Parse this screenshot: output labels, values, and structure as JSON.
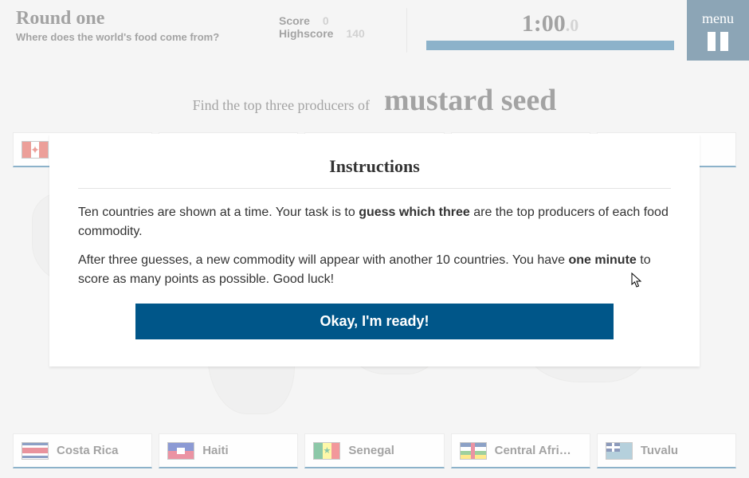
{
  "header": {
    "round_title": "Round one",
    "subtitle": "Where does the world's food come from?",
    "score_label": "Score",
    "score_value": "0",
    "highscore_label": "Highscore",
    "highscore_value": "140",
    "time_main": "1:00",
    "time_dec": ".0",
    "progress_pct": 100,
    "menu_label": "menu"
  },
  "prompt": {
    "lead": "Find the top three producers of",
    "commodity": "mustard seed"
  },
  "countries_top": [
    {
      "name": "Canada",
      "flag": "canada"
    },
    {
      "name": "",
      "flag": "argentina"
    },
    {
      "name": "",
      "flag": "romania"
    },
    {
      "name": "",
      "flag": "czech"
    },
    {
      "name": "",
      "flag": "ukraine"
    }
  ],
  "countries_bottom": [
    {
      "name": "Costa Rica",
      "flag": "costarica"
    },
    {
      "name": "Haiti",
      "flag": "haiti"
    },
    {
      "name": "Senegal",
      "flag": "senegal"
    },
    {
      "name": "Central Afri…",
      "flag": "car"
    },
    {
      "name": "Tuvalu",
      "flag": "tuvalu"
    }
  ],
  "modal": {
    "title": "Instructions",
    "p1_a": "Ten countries are shown at a time. Your task is to ",
    "p1_b": "guess which three",
    "p1_c": " are the top producers of each food commodity.",
    "p2_a": "After three guesses, a new commodity will appear with another 10 countries. You have ",
    "p2_b": "one minute",
    "p2_c": " to score as many points as possible. Good luck!",
    "button": "Okay, I'm ready!"
  }
}
